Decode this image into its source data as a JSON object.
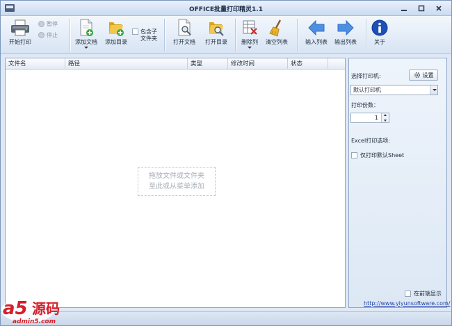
{
  "window": {
    "title": "OFFICE批量打印精灵1.1"
  },
  "toolbar": {
    "start_print": "开始打印",
    "pause": "暂停",
    "stop": "停止",
    "add_document": "添加文档",
    "add_folder": "添加目录",
    "include_subfolders_line1": "包含子",
    "include_subfolders_line2": "文件夹",
    "open_document": "打开文档",
    "open_folder": "打开目录",
    "delete_column": "删除列",
    "clear_list": "清空列表",
    "import_list": "输入列表",
    "export_list": "输出列表",
    "about": "关于"
  },
  "file_list": {
    "columns": [
      "文件名",
      "路径",
      "类型",
      "修改时间",
      "状态"
    ],
    "rows": [],
    "drop_hint_line1": "拖放文件或文件夹",
    "drop_hint_line2": "至此或从菜单添加"
  },
  "settings": {
    "select_printer_label": "选择打印机:",
    "settings_button": "设置",
    "printer_selected": "默认打印机",
    "copies_label": "打印份数：",
    "copies_value": "1",
    "excel_options_label": "Excel打印选项:",
    "print_default_sheet": "仅打印默认Sheet",
    "always_on_top": "在前端显示",
    "website": "http://www.yiyunsoftware.com/"
  },
  "watermark": {
    "brand": "a5源码",
    "domain": "admin5.com"
  },
  "colors": {
    "accent_blue": "#2f6fd0",
    "folder_yellow": "#e8b722",
    "about_blue": "#1d4fb8",
    "delete_red": "#d22b2b"
  }
}
